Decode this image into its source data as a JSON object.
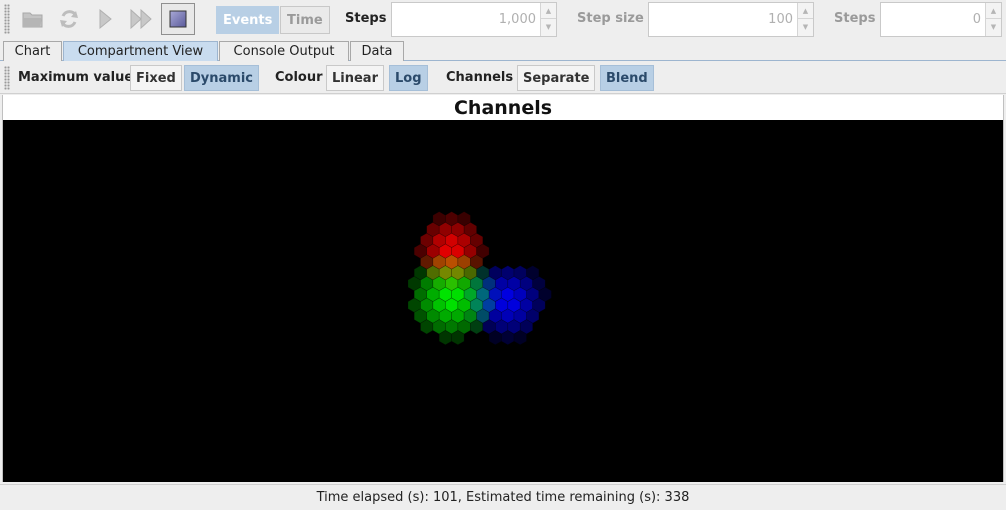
{
  "toolbar": {
    "events_label": "Events",
    "time_label": "Time",
    "steps_label": "Steps",
    "steps_value": "1,000",
    "step_size_label": "Step size",
    "step_size_value": "100",
    "steps2_label": "Steps",
    "steps2_value": "0",
    "icons": [
      "open-folder-icon",
      "refresh-icon",
      "play-icon",
      "fast-forward-icon",
      "stop-icon"
    ]
  },
  "tabs": [
    "Chart",
    "Compartment View",
    "Console Output",
    "Data"
  ],
  "active_tab": "Compartment View",
  "options": {
    "max_value_label": "Maximum value",
    "fixed_label": "Fixed",
    "dynamic_label": "Dynamic",
    "colour_label": "Colour",
    "linear_label": "Linear",
    "log_label": "Log",
    "channels_label": "Channels",
    "separate_label": "Separate",
    "blend_label": "Blend"
  },
  "viewer": {
    "title": "Channels",
    "background": "#000000",
    "channel_colors": {
      "red": "#ff0000",
      "green": "#00ff00",
      "blue": "#0000ff"
    }
  },
  "status": {
    "text": "Time elapsed (s): 101, Estimated time remaining (s): 338"
  },
  "colors": {
    "accent": "#b8cfe5",
    "active_tab": "#c9dcef"
  }
}
